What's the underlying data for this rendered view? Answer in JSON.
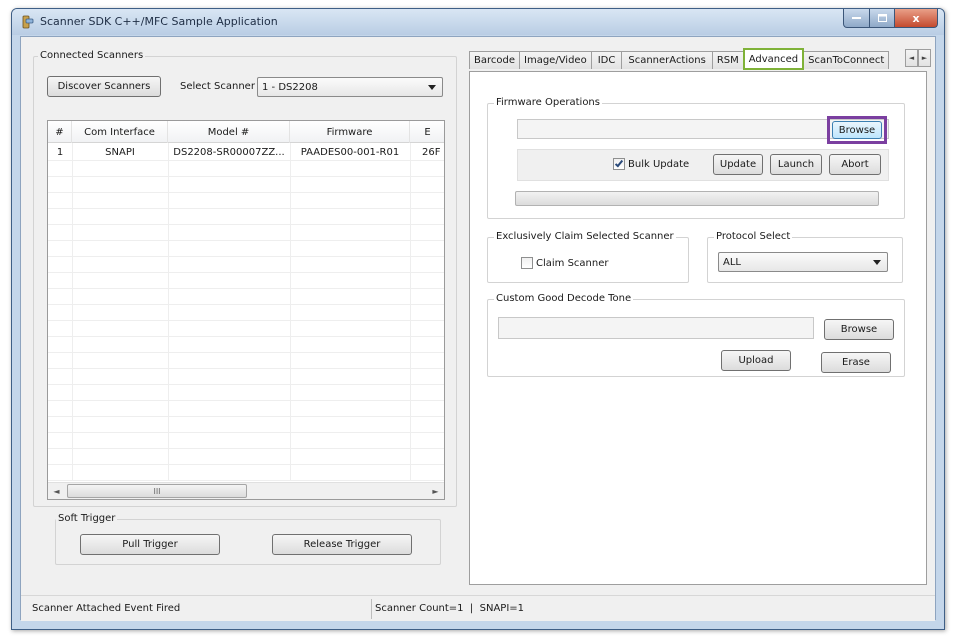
{
  "window": {
    "title": "Scanner SDK C++/MFC Sample Application",
    "close_glyph": "x"
  },
  "connected": {
    "group_label": "Connected Scanners",
    "discover_label": "Discover Scanners",
    "select_label": "Select Scanner",
    "select_value": "1 - DS2208",
    "columns": [
      "#",
      "Com Interface",
      "Model #",
      "Firmware",
      "E"
    ],
    "rows": [
      [
        "1",
        "SNAPI",
        "DS2208-SR00007ZZ...",
        "PAADES00-001-R01",
        "26F"
      ]
    ],
    "scroll_left_glyph": "◄",
    "scroll_right_glyph": "►",
    "scroll_thumb_glyph": "III"
  },
  "soft_trigger": {
    "group_label": "Soft Trigger",
    "pull_label": "Pull Trigger",
    "release_label": "Release Trigger"
  },
  "tabs": {
    "items": [
      "Barcode",
      "Image/Video",
      "IDC",
      "ScannerActions",
      "RSM",
      "Advanced",
      "ScanToConnect"
    ],
    "active": "Advanced",
    "active_outline_color": "#7fb238",
    "scroll_left_glyph": "◄",
    "scroll_right_glyph": "►"
  },
  "advanced": {
    "firmware": {
      "group_label": "Firmware Operations",
      "path_value": "",
      "browse_label": "Browse",
      "browse_highlight_color": "#7b3fa0",
      "bulk_update_label": "Bulk Update",
      "bulk_update_checked": true,
      "update_label": "Update",
      "launch_label": "Launch",
      "abort_label": "Abort",
      "progress_fraction": 0
    },
    "claim": {
      "group_label": "Exclusively Claim Selected Scanner",
      "checkbox_label": "Claim Scanner",
      "checked": false
    },
    "protocol": {
      "group_label": "Protocol Select",
      "value": "ALL"
    },
    "tone": {
      "group_label": "Custom Good Decode Tone",
      "path_value": "",
      "browse_label": "Browse",
      "upload_label": "Upload",
      "erase_label": "Erase"
    }
  },
  "status": {
    "left": "Scanner Attached Event Fired",
    "right": "Scanner Count=1  |  SNAPI=1"
  }
}
